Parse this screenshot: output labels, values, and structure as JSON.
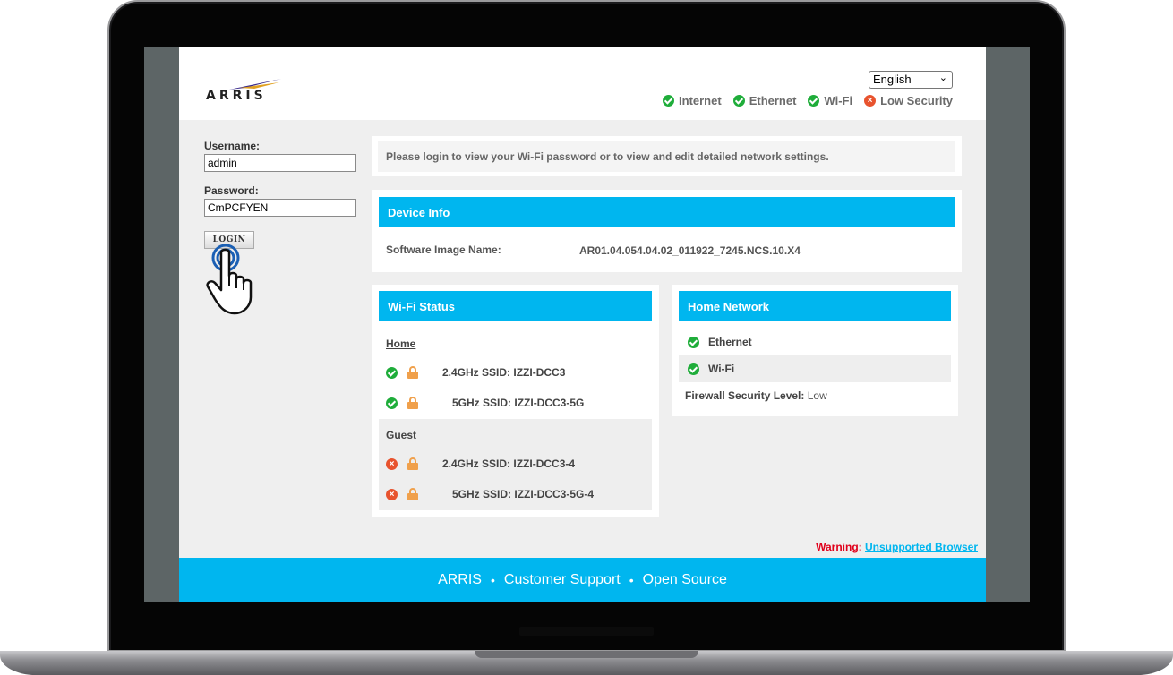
{
  "header": {
    "logo_text": "ARRIS",
    "language": {
      "selected": "English"
    },
    "status": [
      {
        "label": "Internet",
        "state": "ok"
      },
      {
        "label": "Ethernet",
        "state": "ok"
      },
      {
        "label": "Wi-Fi",
        "state": "ok"
      },
      {
        "label": "Low Security",
        "state": "error"
      }
    ]
  },
  "login": {
    "username_label": "Username:",
    "username_value": "admin",
    "password_label": "Password:",
    "password_value": "CmPCFYEN",
    "button_label": "LOGIN"
  },
  "message": "Please login to view your Wi-Fi password or to view and edit detailed network settings.",
  "device_info": {
    "title": "Device Info",
    "software_label": "Software Image Name:",
    "software_value": "AR01.04.054.04.02_011922_7245.NCS.10.X4"
  },
  "wifi_status": {
    "title": "Wi-Fi Status",
    "home": {
      "label": "Home",
      "networks": [
        {
          "band": "2.4GHz SSID:",
          "ssid": "IZZI-DCC3",
          "state": "ok"
        },
        {
          "band": "5GHz SSID:",
          "ssid": "IZZI-DCC3-5G",
          "state": "ok"
        }
      ]
    },
    "guest": {
      "label": "Guest",
      "networks": [
        {
          "band": "2.4GHz SSID:",
          "ssid": "IZZI-DCC3-4",
          "state": "error"
        },
        {
          "band": "5GHz SSID:",
          "ssid": "IZZI-DCC3-5G-4",
          "state": "error"
        }
      ]
    }
  },
  "home_network": {
    "title": "Home Network",
    "items": [
      {
        "label": "Ethernet",
        "state": "ok"
      },
      {
        "label": "Wi-Fi",
        "state": "ok"
      }
    ],
    "firewall_label": "Firewall Security Level:",
    "firewall_value": "Low"
  },
  "warning": {
    "label": "Warning:",
    "link": "Unsupported Browser"
  },
  "footer": {
    "links": [
      "ARRIS",
      "Customer Support",
      "Open Source"
    ],
    "separator": "•"
  },
  "colors": {
    "accent": "#00b6ef",
    "ok": "#1fad3a",
    "error": "#e8532e",
    "lock": "#f0a04b",
    "warning": "#e0001b"
  }
}
